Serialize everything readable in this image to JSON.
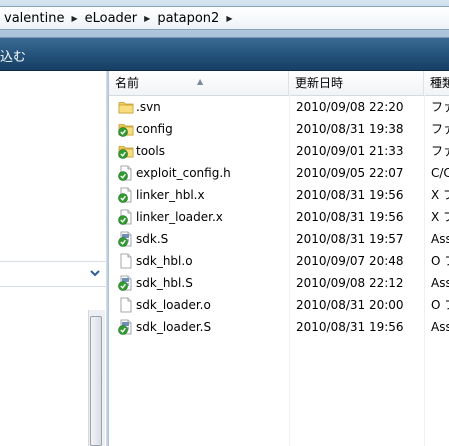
{
  "address": {
    "crumbs": [
      "valentine",
      "eLoader",
      "patapon2"
    ]
  },
  "toolbar": {
    "label": "込む"
  },
  "columns": {
    "name": "名前",
    "date": "更新日時",
    "type": "種類"
  },
  "files": [
    {
      "name": ".svn",
      "date": "2010/09/08 22:20",
      "type": "ファ",
      "icon": "folder-icon"
    },
    {
      "name": "config",
      "date": "2010/08/31 19:38",
      "type": "ファ",
      "icon": "folder-check-icon"
    },
    {
      "name": "tools",
      "date": "2010/09/01 21:33",
      "type": "ファ",
      "icon": "folder-check-icon"
    },
    {
      "name": "exploit_config.h",
      "date": "2010/09/05 22:07",
      "type": "C/C",
      "icon": "file-check-icon"
    },
    {
      "name": "linker_hbl.x",
      "date": "2010/08/31 19:56",
      "type": "X フ",
      "icon": "file-check-icon"
    },
    {
      "name": "linker_loader.x",
      "date": "2010/08/31 19:56",
      "type": "X フ",
      "icon": "file-check-icon"
    },
    {
      "name": "sdk.S",
      "date": "2010/08/31 19:57",
      "type": "Ass",
      "icon": "asm-file-check-icon"
    },
    {
      "name": "sdk_hbl.o",
      "date": "2010/09/07 20:48",
      "type": "O フ",
      "icon": "blank-file-icon"
    },
    {
      "name": "sdk_hbl.S",
      "date": "2010/09/08 22:12",
      "type": "Ass",
      "icon": "asm-file-check-icon"
    },
    {
      "name": "sdk_loader.o",
      "date": "2010/08/31 20:00",
      "type": "O フ",
      "icon": "blank-file-icon"
    },
    {
      "name": "sdk_loader.S",
      "date": "2010/08/31 19:56",
      "type": "Ass",
      "icon": "asm-file-check-icon"
    }
  ],
  "colors": {
    "toolbar": "#24537c",
    "check_green": "#2f9b2f",
    "folder_yellow": "#f2cf5b"
  }
}
